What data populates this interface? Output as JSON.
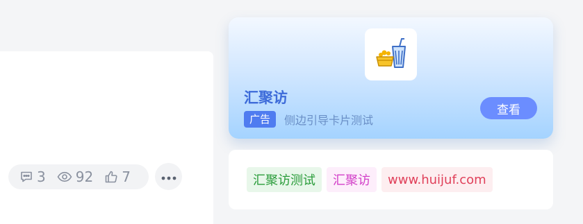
{
  "article": {
    "stats": {
      "comments": "3",
      "views": "92",
      "likes": "7"
    }
  },
  "ad": {
    "title": "汇聚访",
    "badge": "广告",
    "description": "侧边引导卡片测试",
    "view_button": "查看",
    "logo_icon": "drink-and-fries-icon"
  },
  "tags": [
    {
      "label": "汇聚访测试",
      "color": "#2a9c3a"
    },
    {
      "label": "汇聚访",
      "color": "#d23fc8"
    },
    {
      "label": "www.huijuf.com",
      "color": "#e0405a"
    }
  ]
}
